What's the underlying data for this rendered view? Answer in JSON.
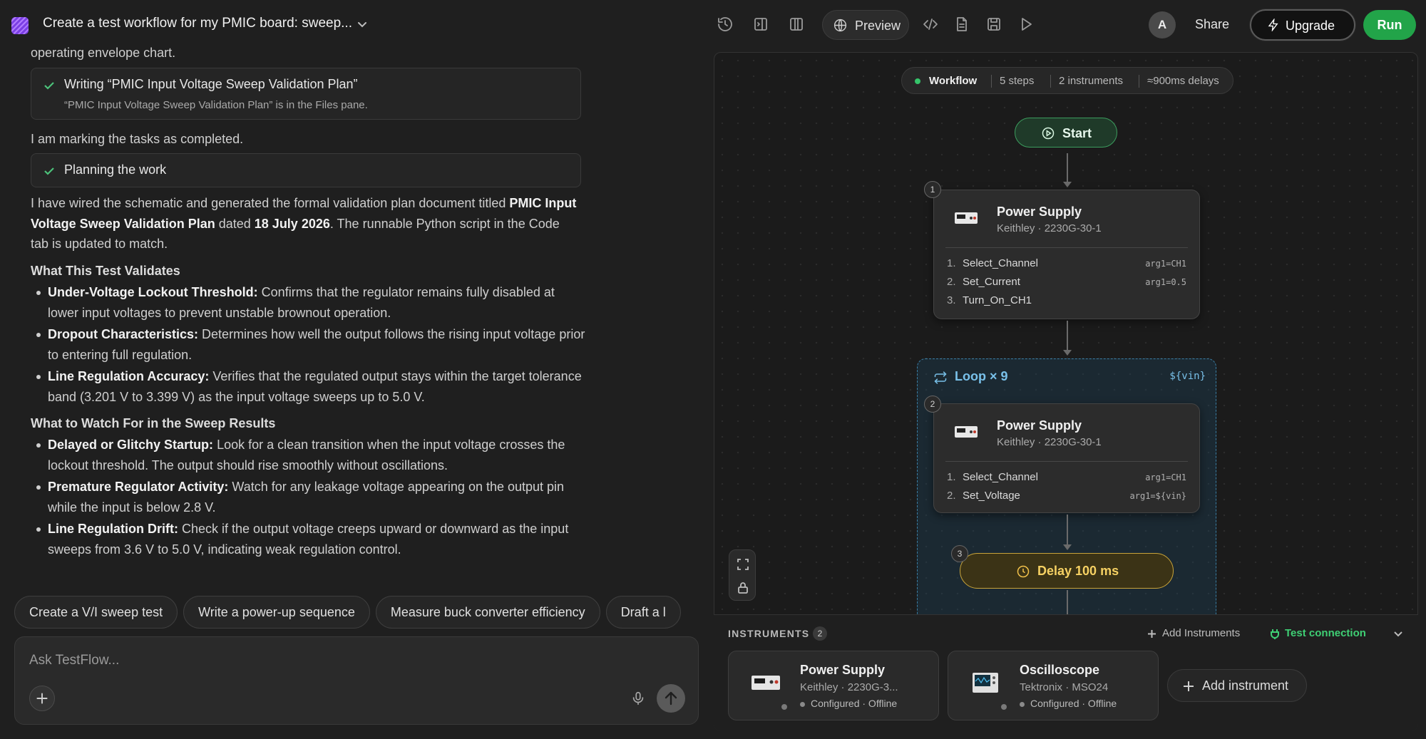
{
  "header": {
    "project_title": "Create a test workflow for my PMIC board: sweep...",
    "preview_label": "Preview",
    "avatar_initial": "A",
    "share_label": "Share",
    "upgrade_label": "Upgrade",
    "run_label": "Run",
    "icons": [
      "history-icon",
      "panel-right-icon",
      "columns-icon",
      "globe-icon",
      "code-icon",
      "file-icon",
      "save-icon",
      "play-icon"
    ]
  },
  "chat": {
    "partial_line": "operating envelope chart.",
    "task1": {
      "title": "Writing “PMIC Input Voltage Sweep Validation Plan”",
      "subtitle": "“PMIC Input Voltage Sweep Validation Plan” is in the Files pane."
    },
    "marking_text": "I am marking the tasks as completed.",
    "task2": {
      "title": "Planning the work"
    },
    "summary": {
      "p1": "I have wired the schematic and generated the formal validation plan document titled ",
      "b1": "PMIC Input Voltage Sweep Validation Plan",
      "p2": " dated ",
      "b2": "18 July 2026",
      "p3": ". The runnable Python script in the Code tab is updated to match."
    },
    "section1": {
      "heading": "What This Test Validates",
      "items": [
        {
          "bold": "Under-Voltage Lockout Threshold:",
          "text": " Confirms that the regulator remains fully disabled at lower input voltages to prevent unstable brownout operation."
        },
        {
          "bold": "Dropout Characteristics:",
          "text": " Determines how well the output follows the rising input voltage prior to entering full regulation."
        },
        {
          "bold": "Line Regulation Accuracy:",
          "text": " Verifies that the regulated output stays within the target tolerance band (3.201 V to 3.399 V) as the input voltage sweeps up to 5.0 V."
        }
      ]
    },
    "section2": {
      "heading": "What to Watch For in the Sweep Results",
      "items": [
        {
          "bold": "Delayed or Glitchy Startup:",
          "text": " Look for a clean transition when the input voltage crosses the lockout threshold. The output should rise smoothly without oscillations."
        },
        {
          "bold": "Premature Regulator Activity:",
          "text": " Watch for any leakage voltage appearing on the output pin while the input is below 2.8 V."
        },
        {
          "bold": "Line Regulation Drift:",
          "text": " Check if the output voltage creeps upward or downward as the input sweeps from 3.6 V to 5.0 V, indicating weak regulation control."
        }
      ]
    },
    "suggestions": [
      "Create a V/I sweep test",
      "Write a power-up sequence",
      "Measure buck converter efficiency",
      "Draft a l"
    ],
    "input_placeholder": "Ask TestFlow..."
  },
  "workflow": {
    "summary": {
      "label": "Workflow",
      "steps": "5 steps",
      "instruments": "2 instruments",
      "delays": "≈900ms delays"
    },
    "start_label": "Start",
    "node1": {
      "number": "1",
      "title": "Power Supply",
      "subtitle": "Keithley · 2230G-30-1",
      "commands": [
        {
          "idx": "1.",
          "name": "Select_Channel",
          "arg": "arg1=CH1"
        },
        {
          "idx": "2.",
          "name": "Set_Current",
          "arg": "arg1=0.5"
        },
        {
          "idx": "3.",
          "name": "Turn_On_CH1",
          "arg": ""
        }
      ]
    },
    "loop": {
      "label": "Loop × 9",
      "variable": "${vin}"
    },
    "node2": {
      "number": "2",
      "title": "Power Supply",
      "subtitle": "Keithley · 2230G-30-1",
      "commands": [
        {
          "idx": "1.",
          "name": "Select_Channel",
          "arg": "arg1=CH1"
        },
        {
          "idx": "2.",
          "name": "Set_Voltage",
          "arg": "arg1=${vin}"
        }
      ]
    },
    "delay": {
      "number": "3",
      "label": "Delay 100 ms"
    }
  },
  "instruments": {
    "heading": "INSTRUMENTS",
    "count": "2",
    "add_link": "Add Instruments",
    "test_connection": "Test connection",
    "cards": [
      {
        "title": "Power Supply",
        "subtitle": "Keithley · 2230G-3...",
        "status": "Configured · Offline"
      },
      {
        "title": "Oscilloscope",
        "subtitle": "Tektronix · MSO24",
        "status": "Configured · Offline"
      }
    ],
    "add_card_label": "Add instrument"
  }
}
